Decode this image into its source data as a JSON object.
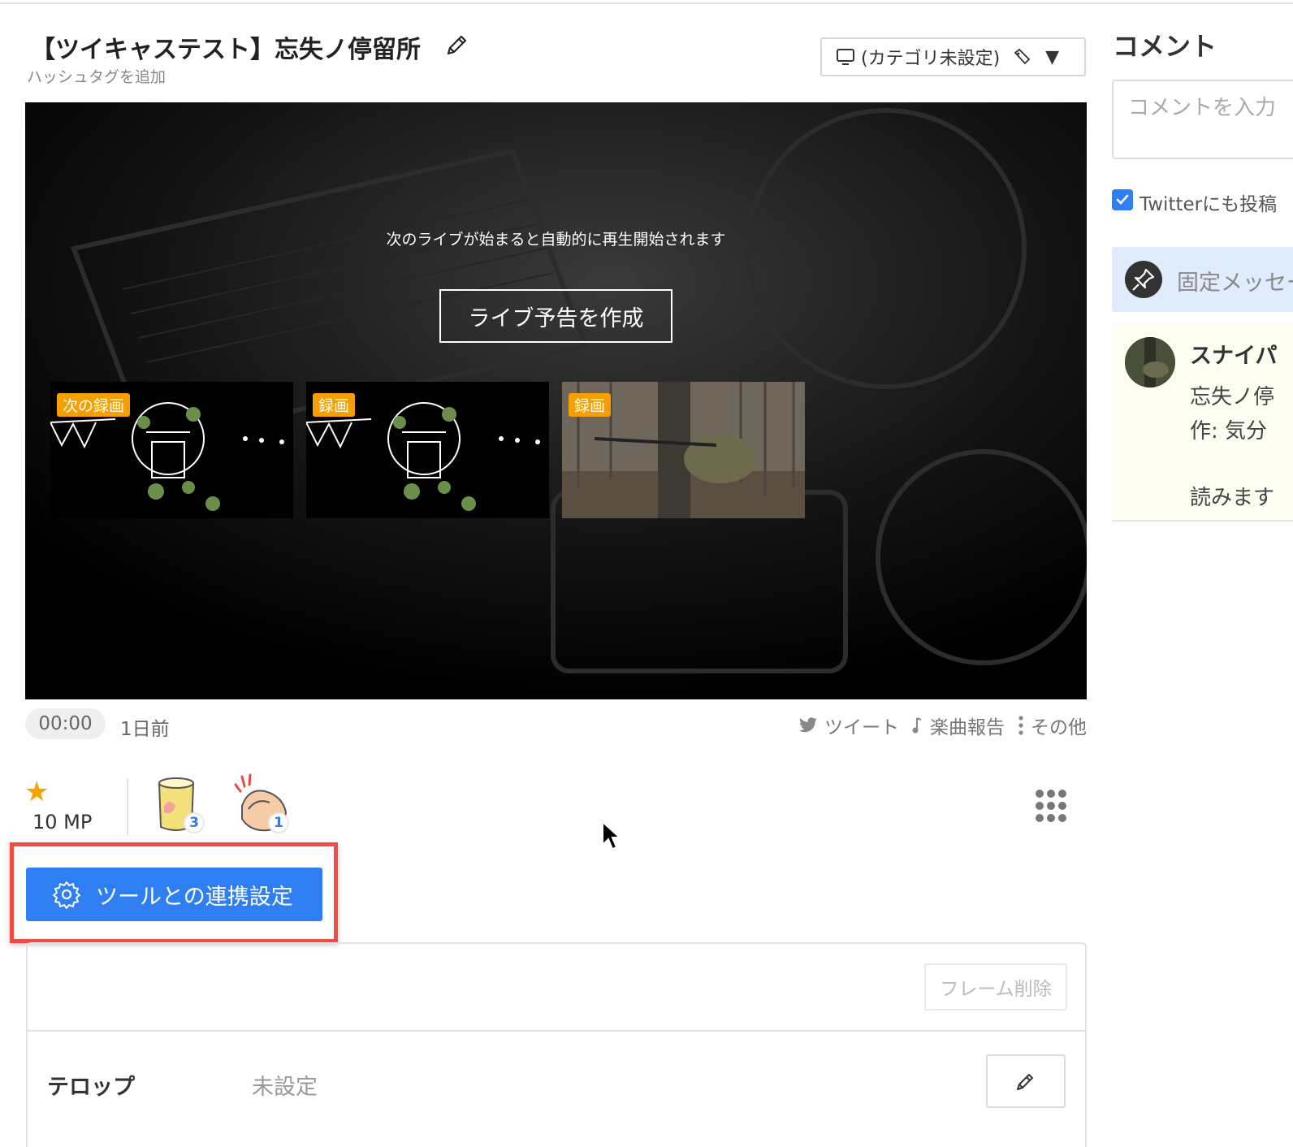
{
  "stream": {
    "title": "【ツイキャステスト】忘失ノ停留所",
    "hashtag_link": "ハッシュタグを追加",
    "category": "(カテゴリ未設定)"
  },
  "player": {
    "message": "次のライブが始まると自動的に再生開始されます",
    "create_preview_button": "ライブ予告を作成",
    "thumbnails": [
      {
        "tag": "次の録画"
      },
      {
        "tag": "録画"
      },
      {
        "tag": "録画"
      }
    ]
  },
  "meta": {
    "elapsed": "00:00",
    "ago": "1日前",
    "tweet": "ツイート",
    "song_report": "楽曲報告",
    "more": "その他"
  },
  "gifts": {
    "mp": "10 MP",
    "items": [
      {
        "icon": "tea-cup-icon",
        "count": "3"
      },
      {
        "icon": "clapping-hands-icon",
        "count": "1"
      }
    ]
  },
  "tool_settings_button": "ツールとの連携設定",
  "frame": {
    "delete_button": "フレーム削除"
  },
  "telop": {
    "label": "テロップ",
    "value": "未設定"
  },
  "comments": {
    "title": "コメント",
    "placeholder": "コメントを入力",
    "twitter_post": "Twitterにも投稿",
    "twitter_checked": true,
    "pinned_label": "固定メッセージ",
    "message": {
      "user": "スナイパ",
      "lines": [
        "忘失ノ停",
        "作: 気分",
        "読みます"
      ]
    }
  },
  "colors": {
    "primary_button": "#2f7ff2",
    "highlight_border": "#ef4c48",
    "tag_orange": "#f5a000",
    "star": "#f5a300"
  }
}
